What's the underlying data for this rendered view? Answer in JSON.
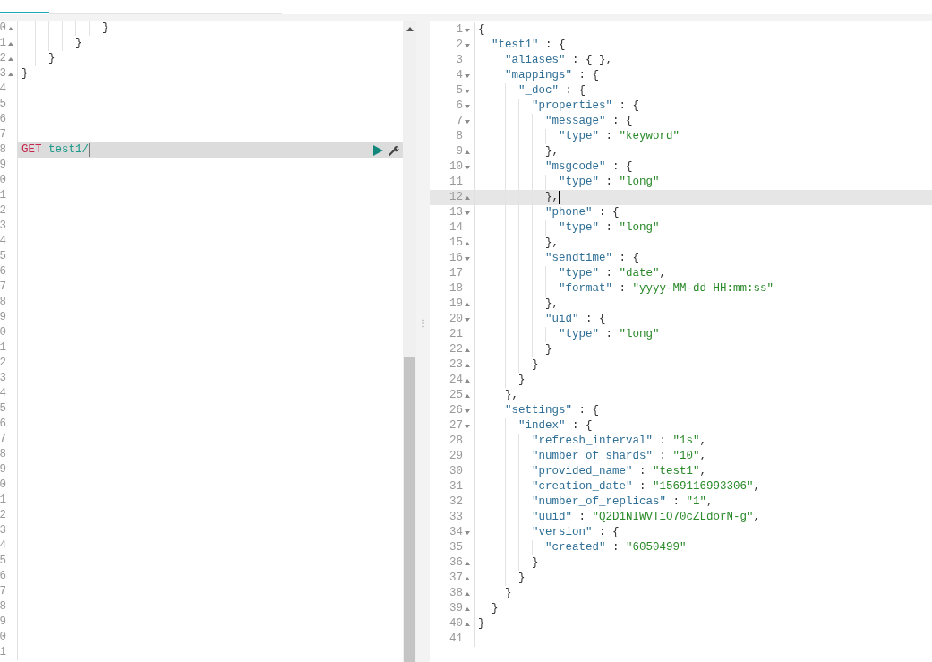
{
  "left_editor": {
    "lines": [
      {
        "number": "0",
        "fold_start": false,
        "fold_end": true,
        "kind": "code",
        "text": "            }",
        "active": false
      },
      {
        "number": "1",
        "fold_start": false,
        "fold_end": true,
        "kind": "code",
        "text": "        }",
        "active": false
      },
      {
        "number": "2",
        "fold_start": false,
        "fold_end": true,
        "kind": "code",
        "text": "    }",
        "active": false
      },
      {
        "number": "3",
        "fold_start": false,
        "fold_end": true,
        "kind": "code",
        "text": "}",
        "active": false
      },
      {
        "number": "4",
        "fold_start": false,
        "fold_end": false,
        "kind": "code",
        "active": false
      },
      {
        "number": "5",
        "fold_start": false,
        "fold_end": false,
        "kind": "code",
        "active": false
      },
      {
        "number": "6",
        "fold_start": false,
        "fold_end": false,
        "kind": "code",
        "active": false
      },
      {
        "number": "7",
        "fold_start": false,
        "fold_end": false,
        "kind": "code",
        "active": false
      },
      {
        "number": "8",
        "fold_start": false,
        "fold_end": false,
        "kind": "request",
        "method": "GET",
        "path": "test1/",
        "active": true
      },
      {
        "number": "9",
        "fold_start": false,
        "fold_end": false,
        "kind": "code",
        "active": false
      },
      {
        "number": "0",
        "fold_start": false,
        "fold_end": false,
        "kind": "code",
        "active": false
      },
      {
        "number": "1",
        "fold_start": false,
        "fold_end": false,
        "kind": "code",
        "active": false
      },
      {
        "number": "2",
        "fold_start": false,
        "fold_end": false,
        "kind": "code",
        "active": false
      },
      {
        "number": "3",
        "fold_start": false,
        "fold_end": false,
        "kind": "code",
        "active": false
      },
      {
        "number": "4",
        "fold_start": false,
        "fold_end": false,
        "kind": "code",
        "active": false
      },
      {
        "number": "5",
        "fold_start": false,
        "fold_end": false,
        "kind": "code",
        "active": false
      },
      {
        "number": "6",
        "fold_start": false,
        "fold_end": false,
        "kind": "code",
        "active": false
      },
      {
        "number": "7",
        "fold_start": false,
        "fold_end": false,
        "kind": "code",
        "active": false
      },
      {
        "number": "8",
        "fold_start": false,
        "fold_end": false,
        "kind": "code",
        "active": false
      },
      {
        "number": "9",
        "fold_start": false,
        "fold_end": false,
        "kind": "code",
        "active": false
      },
      {
        "number": "0",
        "fold_start": false,
        "fold_end": false,
        "kind": "code",
        "active": false
      },
      {
        "number": "1",
        "fold_start": false,
        "fold_end": false,
        "kind": "code",
        "active": false
      },
      {
        "number": "2",
        "fold_start": false,
        "fold_end": false,
        "kind": "code",
        "active": false
      },
      {
        "number": "3",
        "fold_start": false,
        "fold_end": false,
        "kind": "code",
        "active": false
      },
      {
        "number": "4",
        "fold_start": false,
        "fold_end": false,
        "kind": "code",
        "active": false
      },
      {
        "number": "5",
        "fold_start": false,
        "fold_end": false,
        "kind": "code",
        "active": false
      },
      {
        "number": "6",
        "fold_start": false,
        "fold_end": false,
        "kind": "code",
        "active": false
      },
      {
        "number": "7",
        "fold_start": false,
        "fold_end": false,
        "kind": "code",
        "active": false
      },
      {
        "number": "8",
        "fold_start": false,
        "fold_end": false,
        "kind": "code",
        "active": false
      },
      {
        "number": "9",
        "fold_start": false,
        "fold_end": false,
        "kind": "code",
        "active": false
      },
      {
        "number": "0",
        "fold_start": false,
        "fold_end": false,
        "kind": "code",
        "active": false
      },
      {
        "number": "1",
        "fold_start": false,
        "fold_end": false,
        "kind": "code",
        "active": false
      },
      {
        "number": "2",
        "fold_start": false,
        "fold_end": false,
        "kind": "code",
        "active": false
      },
      {
        "number": "3",
        "fold_start": false,
        "fold_end": false,
        "kind": "code",
        "active": false
      },
      {
        "number": "4",
        "fold_start": false,
        "fold_end": false,
        "kind": "code",
        "active": false
      },
      {
        "number": "5",
        "fold_start": false,
        "fold_end": false,
        "kind": "code",
        "active": false
      },
      {
        "number": "6",
        "fold_start": false,
        "fold_end": false,
        "kind": "code",
        "active": false
      },
      {
        "number": "7",
        "fold_start": false,
        "fold_end": false,
        "kind": "code",
        "active": false
      },
      {
        "number": "8",
        "fold_start": false,
        "fold_end": false,
        "kind": "code",
        "active": false
      },
      {
        "number": "9",
        "fold_start": false,
        "fold_end": false,
        "kind": "code",
        "active": false
      },
      {
        "number": "0",
        "fold_start": false,
        "fold_end": false,
        "kind": "code",
        "active": false
      },
      {
        "number": "1",
        "fold_start": false,
        "fold_end": false,
        "kind": "code",
        "active": false
      }
    ]
  },
  "right_editor": {
    "lines": [
      {
        "number": "1",
        "fold_start": true,
        "fold_end": false,
        "text": "{",
        "active": false
      },
      {
        "number": "2",
        "fold_start": true,
        "fold_end": false,
        "text": "  \"test1\" : {",
        "active": false
      },
      {
        "number": "3",
        "fold_start": false,
        "fold_end": false,
        "text": "    \"aliases\" : { },",
        "active": false
      },
      {
        "number": "4",
        "fold_start": true,
        "fold_end": false,
        "text": "    \"mappings\" : {",
        "active": false
      },
      {
        "number": "5",
        "fold_start": true,
        "fold_end": false,
        "text": "      \"_doc\" : {",
        "active": false
      },
      {
        "number": "6",
        "fold_start": true,
        "fold_end": false,
        "text": "        \"properties\" : {",
        "active": false
      },
      {
        "number": "7",
        "fold_start": true,
        "fold_end": false,
        "text": "          \"message\" : {",
        "active": false
      },
      {
        "number": "8",
        "fold_start": false,
        "fold_end": false,
        "text": "            \"type\" : \"keyword\"",
        "active": false
      },
      {
        "number": "9",
        "fold_start": false,
        "fold_end": true,
        "text": "          },",
        "active": false
      },
      {
        "number": "10",
        "fold_start": true,
        "fold_end": false,
        "text": "          \"msgcode\" : {",
        "active": false
      },
      {
        "number": "11",
        "fold_start": false,
        "fold_end": false,
        "text": "            \"type\" : \"long\"",
        "active": false
      },
      {
        "number": "12",
        "fold_start": false,
        "fold_end": true,
        "text": "          },",
        "active": true
      },
      {
        "number": "13",
        "fold_start": true,
        "fold_end": false,
        "text": "          \"phone\" : {",
        "active": false
      },
      {
        "number": "14",
        "fold_start": false,
        "fold_end": false,
        "text": "            \"type\" : \"long\"",
        "active": false
      },
      {
        "number": "15",
        "fold_start": false,
        "fold_end": true,
        "text": "          },",
        "active": false
      },
      {
        "number": "16",
        "fold_start": true,
        "fold_end": false,
        "text": "          \"sendtime\" : {",
        "active": false
      },
      {
        "number": "17",
        "fold_start": false,
        "fold_end": false,
        "text": "            \"type\" : \"date\",",
        "active": false
      },
      {
        "number": "18",
        "fold_start": false,
        "fold_end": false,
        "text": "            \"format\" : \"yyyy-MM-dd HH:mm:ss\"",
        "active": false
      },
      {
        "number": "19",
        "fold_start": false,
        "fold_end": true,
        "text": "          },",
        "active": false
      },
      {
        "number": "20",
        "fold_start": true,
        "fold_end": false,
        "text": "          \"uid\" : {",
        "active": false
      },
      {
        "number": "21",
        "fold_start": false,
        "fold_end": false,
        "text": "            \"type\" : \"long\"",
        "active": false
      },
      {
        "number": "22",
        "fold_start": false,
        "fold_end": true,
        "text": "          }",
        "active": false
      },
      {
        "number": "23",
        "fold_start": false,
        "fold_end": true,
        "text": "        }",
        "active": false
      },
      {
        "number": "24",
        "fold_start": false,
        "fold_end": true,
        "text": "      }",
        "active": false
      },
      {
        "number": "25",
        "fold_start": false,
        "fold_end": true,
        "text": "    },",
        "active": false
      },
      {
        "number": "26",
        "fold_start": true,
        "fold_end": false,
        "text": "    \"settings\" : {",
        "active": false
      },
      {
        "number": "27",
        "fold_start": true,
        "fold_end": false,
        "text": "      \"index\" : {",
        "active": false
      },
      {
        "number": "28",
        "fold_start": false,
        "fold_end": false,
        "text": "        \"refresh_interval\" : \"1s\",",
        "active": false
      },
      {
        "number": "29",
        "fold_start": false,
        "fold_end": false,
        "text": "        \"number_of_shards\" : \"10\",",
        "active": false
      },
      {
        "number": "30",
        "fold_start": false,
        "fold_end": false,
        "text": "        \"provided_name\" : \"test1\",",
        "active": false
      },
      {
        "number": "31",
        "fold_start": false,
        "fold_end": false,
        "text": "        \"creation_date\" : \"1569116993306\",",
        "active": false
      },
      {
        "number": "32",
        "fold_start": false,
        "fold_end": false,
        "text": "        \"number_of_replicas\" : \"1\",",
        "active": false
      },
      {
        "number": "33",
        "fold_start": false,
        "fold_end": false,
        "text": "        \"uuid\" : \"Q2D1NIWVTiO70cZLdorN-g\",",
        "active": false
      },
      {
        "number": "34",
        "fold_start": true,
        "fold_end": false,
        "text": "        \"version\" : {",
        "active": false
      },
      {
        "number": "35",
        "fold_start": false,
        "fold_end": false,
        "text": "          \"created\" : \"6050499\"",
        "active": false
      },
      {
        "number": "36",
        "fold_start": false,
        "fold_end": true,
        "text": "        }",
        "active": false
      },
      {
        "number": "37",
        "fold_start": false,
        "fold_end": true,
        "text": "      }",
        "active": false
      },
      {
        "number": "38",
        "fold_start": false,
        "fold_end": true,
        "text": "    }",
        "active": false
      },
      {
        "number": "39",
        "fold_start": false,
        "fold_end": true,
        "text": "  }",
        "active": false
      },
      {
        "number": "40",
        "fold_start": false,
        "fold_end": true,
        "text": "}",
        "active": false
      },
      {
        "number": "41",
        "fold_start": false,
        "fold_end": false,
        "active": false
      }
    ]
  }
}
